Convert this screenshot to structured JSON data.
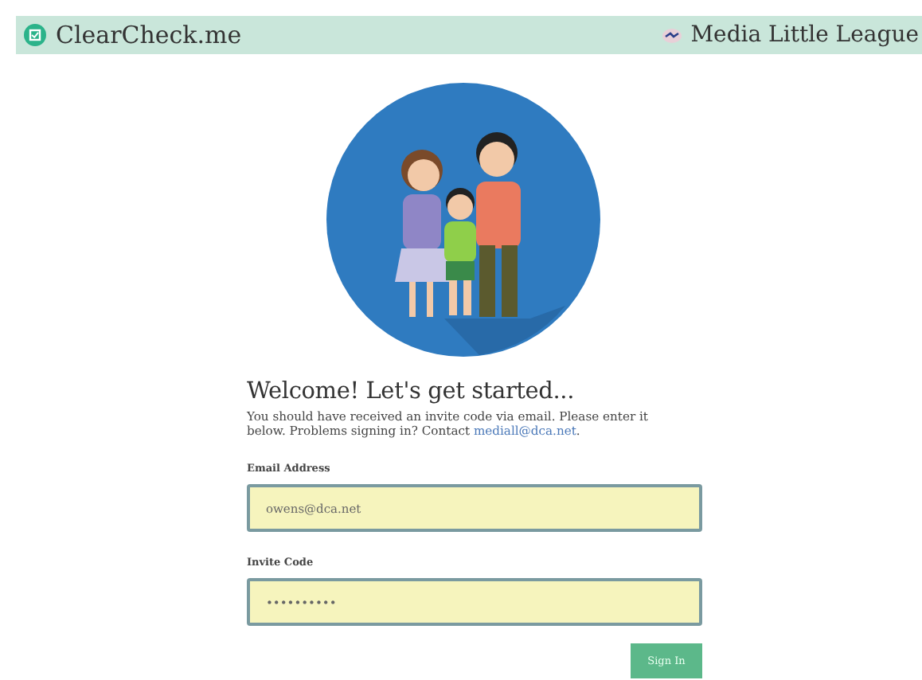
{
  "header": {
    "brand": "ClearCheck.me",
    "organization": "Media Little League"
  },
  "heading": "Welcome! Let's get started...",
  "intro": {
    "text": "You should have received an invite code via email. Please enter it below. Problems signing in? Contact ",
    "link": "mediall@dca.net",
    "end": "."
  },
  "fields": [
    {
      "label": "Email Address",
      "value": "owens@dca.net"
    },
    {
      "label": "Invite Code",
      "value": "••••••••••"
    }
  ],
  "button": "Sign In"
}
